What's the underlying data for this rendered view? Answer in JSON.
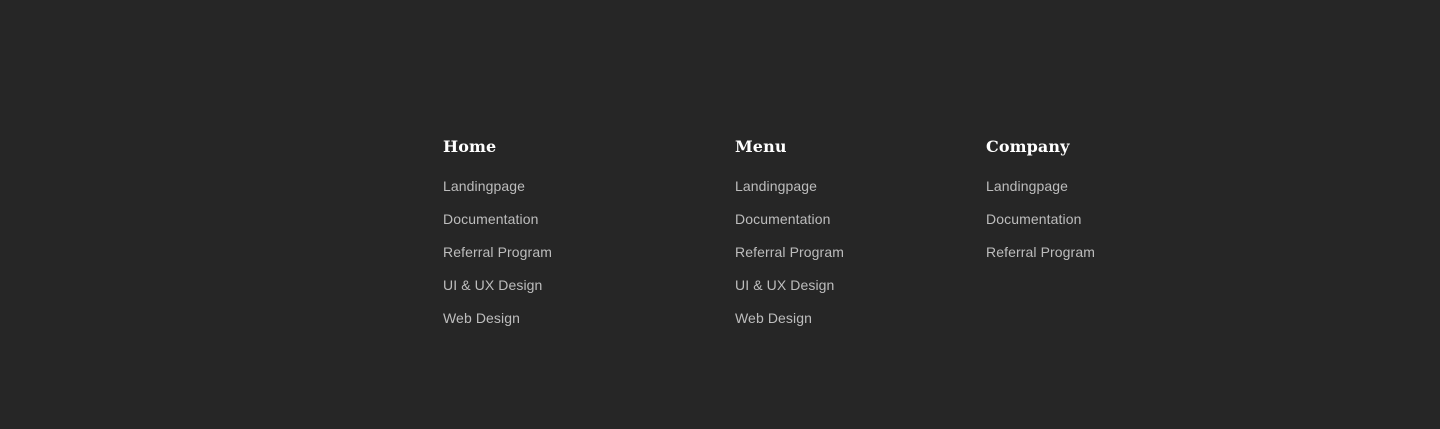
{
  "colors": {
    "background": "#262626",
    "heading": "#ffffff",
    "link": "#bdbdbd"
  },
  "footer": {
    "columns": [
      {
        "title": "Home",
        "links": [
          "Landingpage",
          "Documentation",
          "Referral Program",
          "UI & UX Design",
          "Web Design"
        ]
      },
      {
        "title": "Menu",
        "links": [
          "Landingpage",
          "Documentation",
          "Referral Program",
          "UI & UX Design",
          "Web Design"
        ]
      },
      {
        "title": "Company",
        "links": [
          "Landingpage",
          "Documentation",
          "Referral Program"
        ]
      }
    ]
  }
}
